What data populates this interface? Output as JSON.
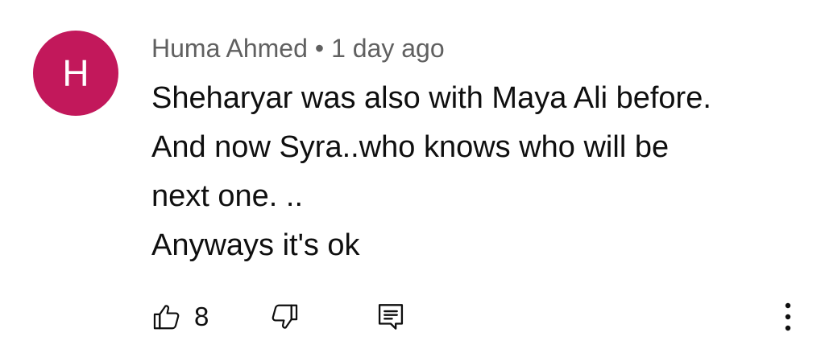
{
  "comment": {
    "avatar": {
      "initial": "H",
      "color": "#c2185b"
    },
    "author": "Huma Ahmed",
    "separator": "•",
    "timestamp": "1 day ago",
    "text_lines": [
      "Sheharyar was also with Maya Ali before.",
      "And now Syra..who knows who will be",
      "next one. ..",
      "Anyways it's ok"
    ],
    "actions": {
      "like_count": "8",
      "like_icon": "thumbs-up-icon",
      "dislike_icon": "thumbs-down-icon",
      "reply_icon": "reply-comment-icon",
      "more_icon": "more-vertical-icon"
    }
  }
}
